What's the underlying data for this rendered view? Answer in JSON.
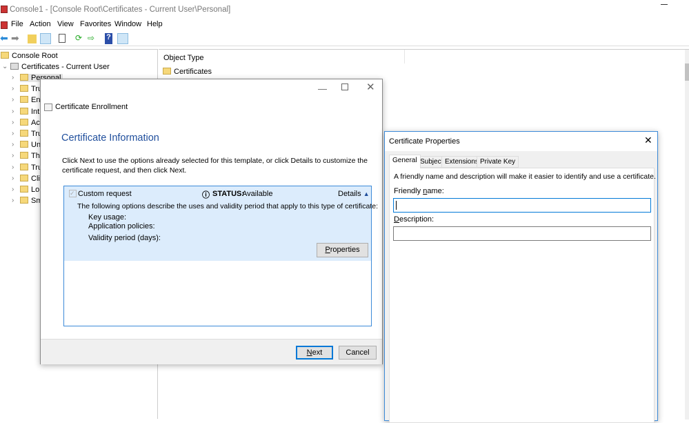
{
  "window": {
    "title": "Console1 - [Console Root\\Certificates - Current User\\Personal]"
  },
  "menu": [
    "File",
    "Action",
    "View",
    "Favorites",
    "Window",
    "Help"
  ],
  "toolbar": {
    "icons": [
      "back-arrow-icon",
      "forward-arrow-icon",
      "up-folder-icon",
      "show-hide-tree-icon",
      "clipboard-icon",
      "refresh-icon",
      "export-list-icon",
      "help-icon",
      "action-pane-icon"
    ]
  },
  "tree": {
    "root": "Console Root",
    "store": "Certificates - Current User",
    "children": [
      "Personal",
      "Tru",
      "Ent",
      "Int",
      "Ac",
      "Tru",
      "Un",
      "Th",
      "Tru",
      "Cli",
      "Lo",
      "Sm"
    ]
  },
  "list": {
    "column": "Object Type",
    "items": [
      "Certificates"
    ]
  },
  "enroll": {
    "title": "Certificate Enrollment",
    "heading": "Certificate Information",
    "intro": "Click Next to use the options already selected for this template, or click Details to customize the certificate request, and then click Next.",
    "request_label": "Custom request",
    "status_label": "STATUS:",
    "status_value": "Available",
    "details": "Details",
    "desc": "The following options describe the uses and validity period that apply to this type of certificate:",
    "fields": [
      "Key usage:",
      "Application policies:",
      "Validity period (days):"
    ],
    "properties_btn": "Properties",
    "next_btn": "Next",
    "cancel_btn": "Cancel",
    "accent": "#0078d7",
    "panel_bg": "#dcecfc"
  },
  "props": {
    "title": "Certificate Properties",
    "tabs": [
      "General",
      "Subject",
      "Extensions",
      "Private Key"
    ],
    "active_tab": "General",
    "hint": "A friendly name and description will make it easier to identify and use a certificate.",
    "friendly_label": "Friendly name:",
    "friendly_value": "",
    "description_label": "Description:",
    "description_value": ""
  }
}
